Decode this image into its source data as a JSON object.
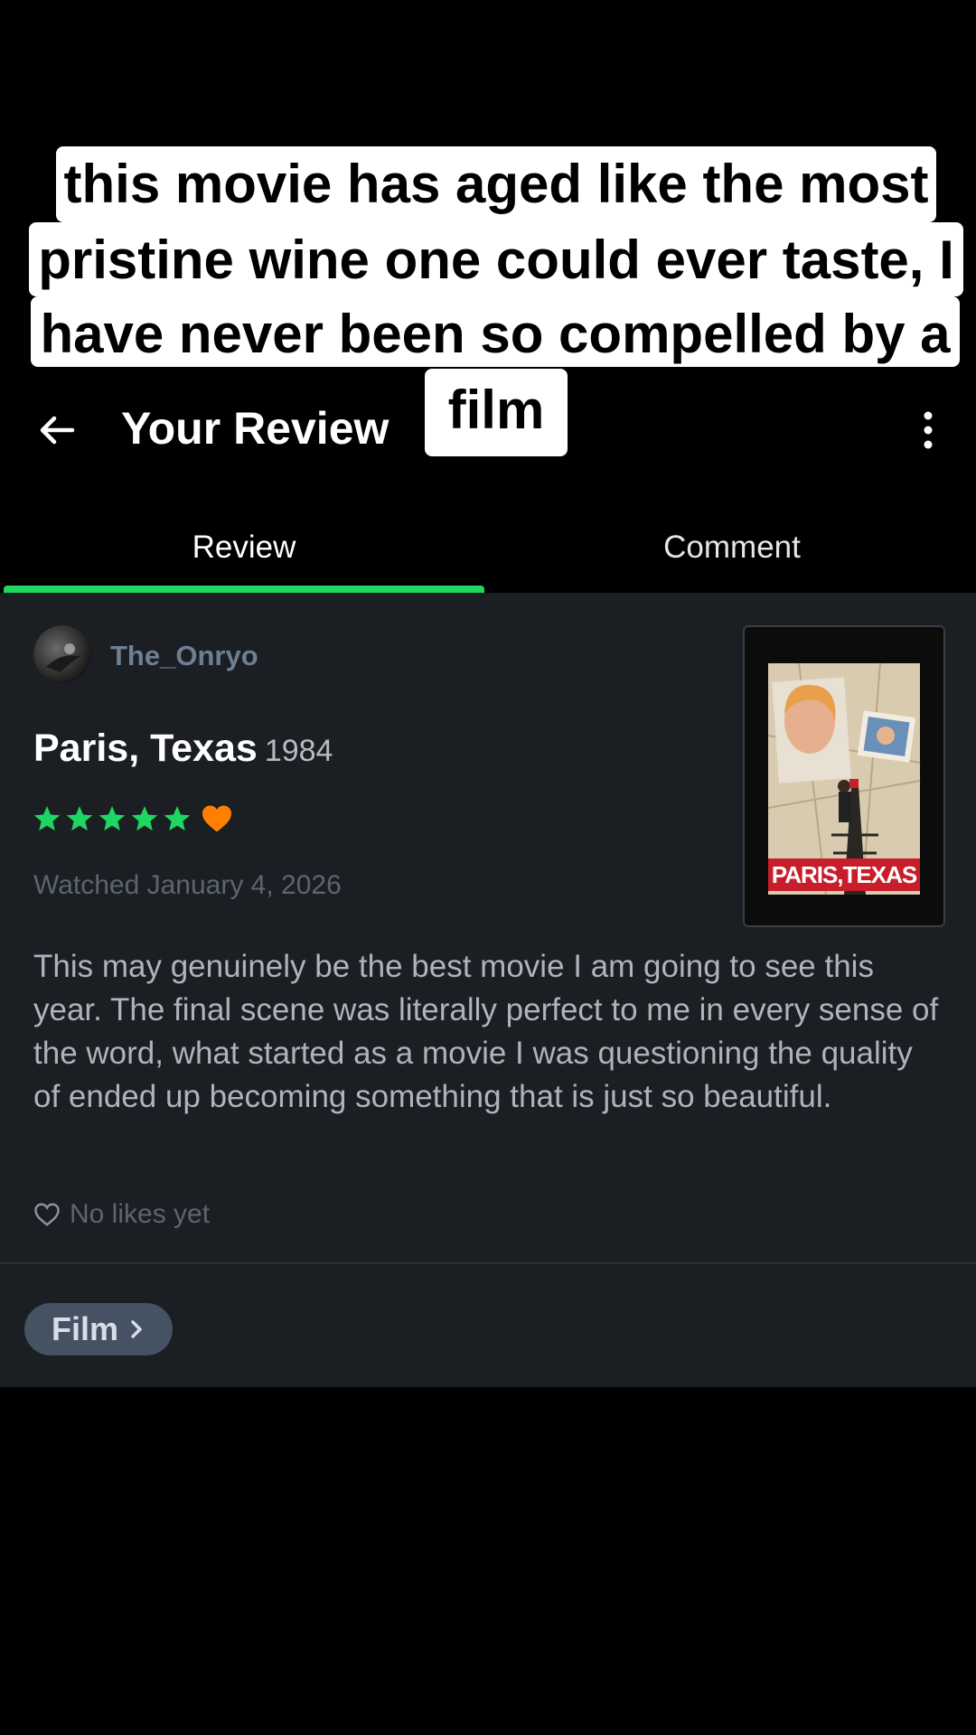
{
  "caption": {
    "lines": [
      "this movie has aged like the most",
      "pristine wine one could ever taste, I",
      "have never been so compelled by a",
      "film"
    ]
  },
  "header": {
    "title": "Your Review",
    "back_icon": "arrow-left-icon",
    "menu_icon": "more-vertical-icon"
  },
  "tabs": [
    {
      "label": "Review",
      "active": true
    },
    {
      "label": "Comment",
      "active": false
    }
  ],
  "review": {
    "username": "The_Onryo",
    "film_title": "Paris, Texas",
    "year": "1984",
    "rating_stars": 5,
    "liked": true,
    "watched": "Watched January 4, 2026",
    "text": "This may genuinely be the best movie I am going to see this year. The final scene was literally perfect to me in every sense of the word, what started as a movie I was questioning the quality of ended up becoming something that is just so beautiful.",
    "likes_text": "No likes yet",
    "poster_title": "PARIS,TEXAS"
  },
  "footer": {
    "chip_label": "Film"
  },
  "colors": {
    "accent_green": "#1ed760",
    "heart_orange": "#ff8000",
    "card_bg": "#1b1e22",
    "chip_bg": "#445263"
  }
}
